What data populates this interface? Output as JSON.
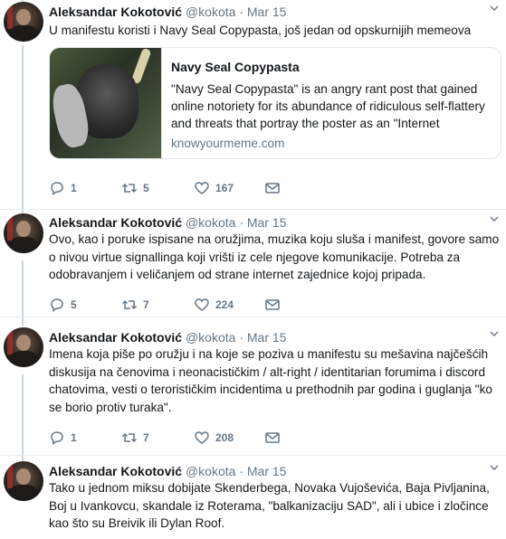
{
  "tweets": [
    {
      "name": "Aleksandar Kokotović",
      "handle": "@kokota",
      "separator": "·",
      "date": "Mar 15",
      "text": "U manifestu koristi i Navy Seal Copypasta, još jedan od opskurnijih memeova",
      "card": {
        "title": "Navy Seal Copypasta",
        "description": "\"Navy Seal Copypasta\" is an angry rant post that gained online notoriety for its abundance of ridiculous self-flattery and threats that portray the poster as an \"Internet",
        "domain": "knowyourmeme.com"
      },
      "replies": "1",
      "retweets": "5",
      "likes": "167"
    },
    {
      "name": "Aleksandar Kokotović",
      "handle": "@kokota",
      "separator": "·",
      "date": "Mar 15",
      "text": "Ovo, kao i poruke ispisane na oružjima, muzika koju sluša i manifest, govore samo o nivou virtue signallinga koji vrišti iz cele njegove komunikacije. Potreba za odobravanjem i veličanjem od strane internet zajednice kojoj pripada.",
      "replies": "5",
      "retweets": "7",
      "likes": "224"
    },
    {
      "name": "Aleksandar Kokotović",
      "handle": "@kokota",
      "separator": "·",
      "date": "Mar 15",
      "text": "Imena koja piše po oružju i na koje se poziva u manifestu su mešavina najčešćih diskusija na čenovima i neonacističkim / alt-right / identitarian forumima i discord chatovima, vesti o terorističkim incidentima u prethodnih par godina i guglanja \"ko se borio protiv turaka\".",
      "replies": "1",
      "retweets": "7",
      "likes": "208"
    },
    {
      "name": "Aleksandar Kokotović",
      "handle": "@kokota",
      "separator": "·",
      "date": "Mar 15",
      "text": "Tako u jednom miksu dobijate Skenderbega, Novaka Vujoševića, Baja Pivljanina, Boj u Ivankovcu, skandale iz Roterama, \"balkanizaciju SAD\", ali i ubice i zločince kao što su Breivik ili Dylan Roof."
    }
  ],
  "icons": {
    "reply": "reply-icon",
    "retweet": "retweet-icon",
    "like": "heart-icon",
    "message": "envelope-icon",
    "menu": "chevron-down-icon"
  },
  "colors": {
    "thread_line": "#ccd6dd",
    "secondary_text": "#657786",
    "divider": "#e6ecf0"
  }
}
